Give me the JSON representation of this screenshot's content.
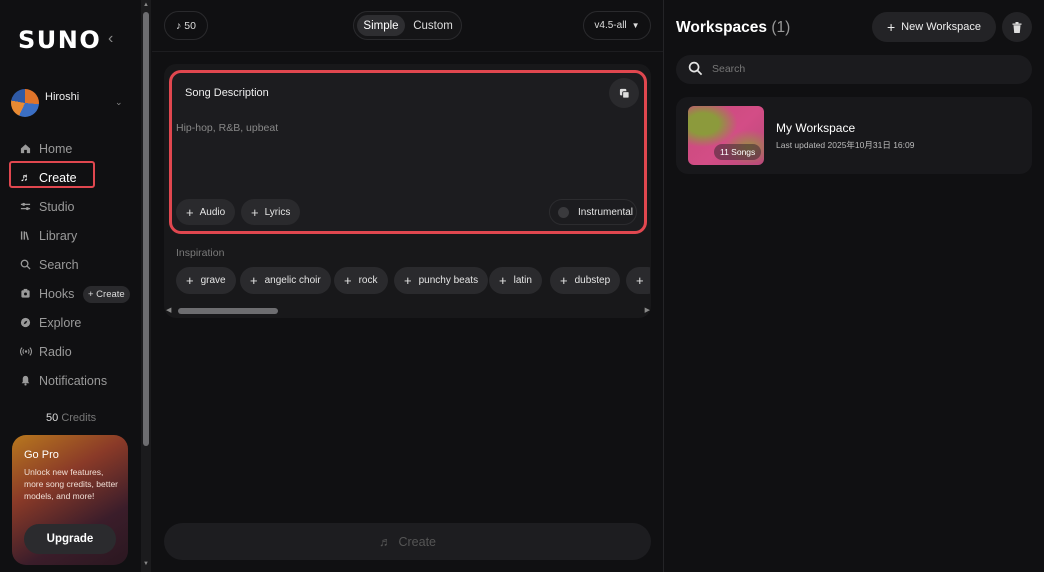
{
  "brand": {
    "logo": "SUNO"
  },
  "user": {
    "name": "Hiroshi"
  },
  "nav": {
    "items": [
      {
        "id": "home",
        "label": "Home",
        "icon": "home-icon"
      },
      {
        "id": "create",
        "label": "Create",
        "icon": "music-note-icon"
      },
      {
        "id": "studio",
        "label": "Studio",
        "icon": "sliders-icon"
      },
      {
        "id": "library",
        "label": "Library",
        "icon": "library-icon"
      },
      {
        "id": "search",
        "label": "Search",
        "icon": "search-icon"
      },
      {
        "id": "hooks",
        "label": "Hooks",
        "icon": "hooks-icon"
      },
      {
        "id": "explore",
        "label": "Explore",
        "icon": "compass-icon"
      },
      {
        "id": "radio",
        "label": "Radio",
        "icon": "radio-icon"
      },
      {
        "id": "notifications",
        "label": "Notifications",
        "icon": "bell-icon"
      }
    ],
    "hooks_create": "+ Create"
  },
  "credits": {
    "amount": "50",
    "label": "Credits"
  },
  "gopro": {
    "title": "Go Pro",
    "text": "Unlock new features, more song credits, better models, and more!",
    "button": "Upgrade"
  },
  "topbar": {
    "notes_count": "50",
    "mode_simple": "Simple",
    "mode_custom": "Custom",
    "version": "v4.5-all"
  },
  "description": {
    "label": "Song Description",
    "placeholder": "Hip-hop, R&B, upbeat",
    "audio": "Audio",
    "lyrics": "Lyrics",
    "instrumental": "Instrumental"
  },
  "inspiration": {
    "label": "Inspiration",
    "tags": [
      "grave",
      "angelic choir",
      "rock",
      "punchy beats",
      "latin",
      "dubstep",
      ""
    ]
  },
  "create_button": "Create",
  "workspaces": {
    "title": "Workspaces",
    "count": "(1)",
    "new_button": "New Workspace",
    "search_placeholder": "Search",
    "items": [
      {
        "name": "My Workspace",
        "updated": "Last updated 2025年10月31日 16:09",
        "songs": "11 Songs"
      }
    ]
  }
}
